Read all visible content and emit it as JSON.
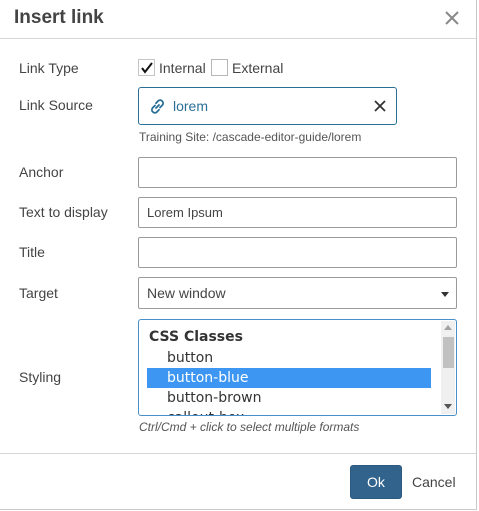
{
  "dialog": {
    "title": "Insert link",
    "close_icon": "close-icon"
  },
  "link_type": {
    "label": "Link Type",
    "options": [
      {
        "label": "Internal",
        "checked": true
      },
      {
        "label": "External",
        "checked": false
      }
    ]
  },
  "link_source": {
    "label": "Link Source",
    "value": "lorem",
    "icon": "link-icon",
    "clear_icon": "close-icon",
    "path": "Training Site: /cascade-editor-guide/lorem",
    "accent_color": "#2a6f97"
  },
  "anchor": {
    "label": "Anchor",
    "value": ""
  },
  "text_to_display": {
    "label": "Text to display",
    "value": "Lorem Ipsum"
  },
  "title_field": {
    "label": "Title",
    "value": ""
  },
  "target": {
    "label": "Target",
    "value": "New window"
  },
  "styling": {
    "label": "Styling",
    "group_label": "CSS Classes",
    "options": [
      "button",
      "button-blue",
      "button-brown",
      "callout-box"
    ],
    "selected": "button-blue",
    "selected_color": "#3d97f2",
    "hint": "Ctrl/Cmd + click to select multiple formats"
  },
  "footer": {
    "ok_label": "Ok",
    "cancel_label": "Cancel",
    "ok_color": "#31638c"
  }
}
